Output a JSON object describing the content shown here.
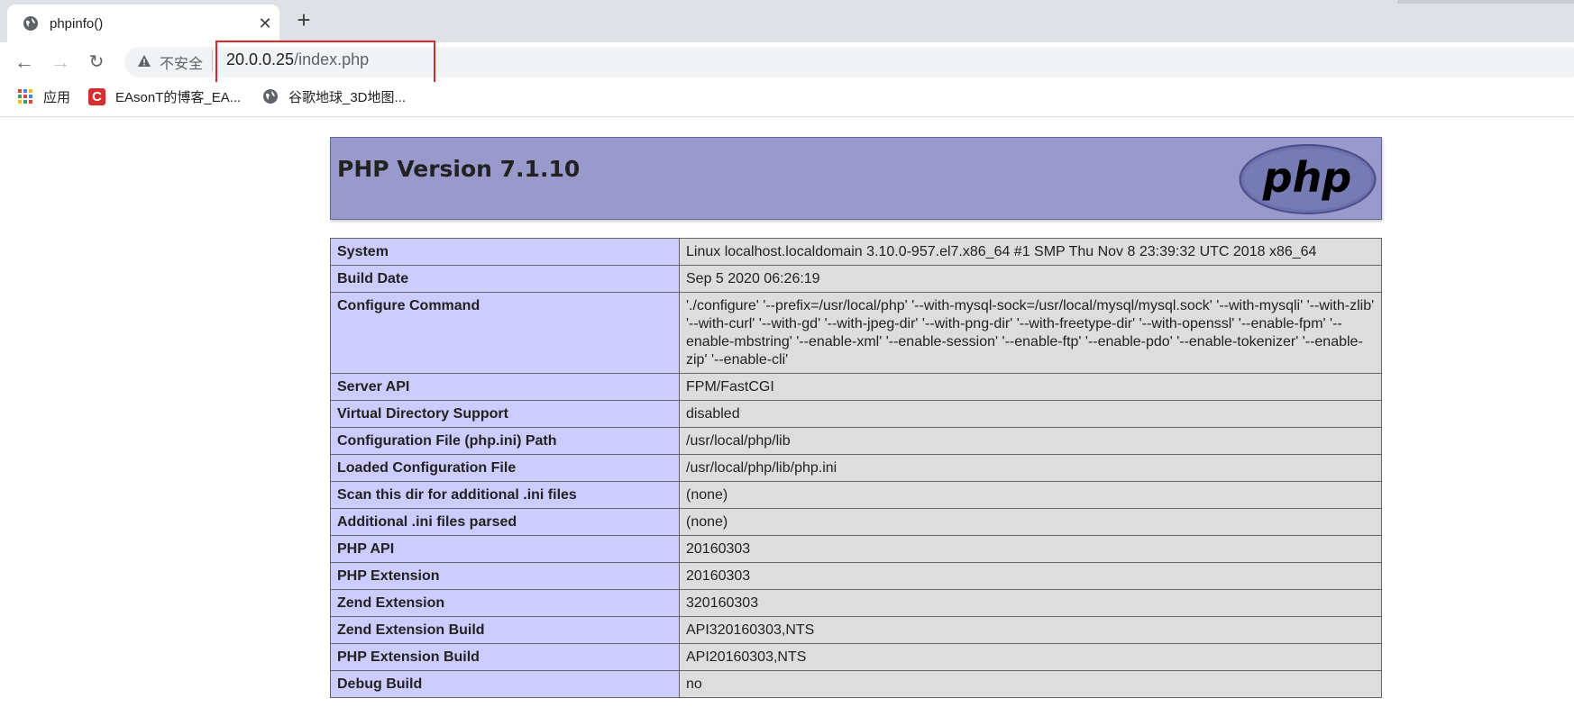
{
  "browser": {
    "tab_title": "phpinfo()",
    "security_label": "不安全",
    "url_host": "20.0.0.25",
    "url_path": "/index.php",
    "bookmarks": [
      {
        "label": "应用",
        "icon": "apps-grid-icon"
      },
      {
        "label": "EAsonT的博客_EA...",
        "icon": "csdn-logo-icon"
      },
      {
        "label": "谷歌地球_3D地图...",
        "icon": "globe-icon"
      }
    ]
  },
  "page": {
    "title": "PHP Version 7.1.10",
    "logo_text": "php",
    "rows": [
      {
        "label": "System",
        "value": "Linux localhost.localdomain 3.10.0-957.el7.x86_64 #1 SMP Thu Nov 8 23:39:32 UTC 2018 x86_64"
      },
      {
        "label": "Build Date",
        "value": "Sep 5 2020 06:26:19"
      },
      {
        "label": "Configure Command",
        "value": "'./configure' '--prefix=/usr/local/php' '--with-mysql-sock=/usr/local/mysql/mysql.sock' '--with-mysqli' '--with-zlib' '--with-curl' '--with-gd' '--with-jpeg-dir' '--with-png-dir' '--with-freetype-dir' '--with-openssl' '--enable-fpm' '--enable-mbstring' '--enable-xml' '--enable-session' '--enable-ftp' '--enable-pdo' '--enable-tokenizer' '--enable-zip' '--enable-cli'"
      },
      {
        "label": "Server API",
        "value": "FPM/FastCGI"
      },
      {
        "label": "Virtual Directory Support",
        "value": "disabled"
      },
      {
        "label": "Configuration File (php.ini) Path",
        "value": "/usr/local/php/lib"
      },
      {
        "label": "Loaded Configuration File",
        "value": "/usr/local/php/lib/php.ini"
      },
      {
        "label": "Scan this dir for additional .ini files",
        "value": "(none)"
      },
      {
        "label": "Additional .ini files parsed",
        "value": "(none)"
      },
      {
        "label": "PHP API",
        "value": "20160303"
      },
      {
        "label": "PHP Extension",
        "value": "20160303"
      },
      {
        "label": "Zend Extension",
        "value": "320160303"
      },
      {
        "label": "Zend Extension Build",
        "value": "API320160303,NTS"
      },
      {
        "label": "PHP Extension Build",
        "value": "API20160303,NTS"
      },
      {
        "label": "Debug Build",
        "value": "no"
      }
    ]
  },
  "colors": {
    "header_bg": "#9999cc",
    "label_cell_bg": "#ccccff",
    "value_cell_bg": "#dddddd",
    "highlight_border": "#e0262c"
  }
}
